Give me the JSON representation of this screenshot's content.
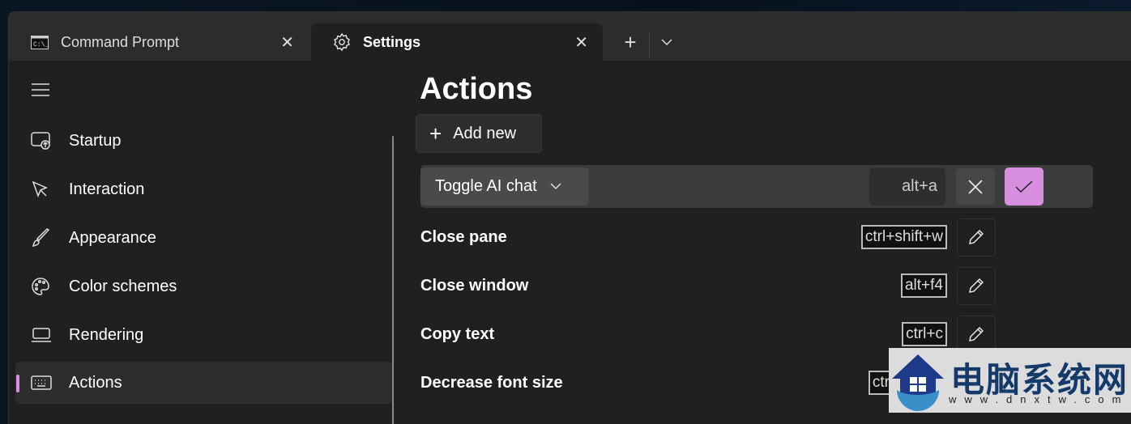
{
  "tabs": [
    {
      "label": "Command Prompt",
      "icon": "cmd-icon"
    },
    {
      "label": "Settings",
      "icon": "gear-icon",
      "active": true
    }
  ],
  "sidebar": {
    "items": [
      {
        "label": "Startup",
        "icon": "startup-icon"
      },
      {
        "label": "Interaction",
        "icon": "cursor-icon"
      },
      {
        "label": "Appearance",
        "icon": "brush-icon"
      },
      {
        "label": "Color schemes",
        "icon": "palette-icon"
      },
      {
        "label": "Rendering",
        "icon": "laptop-icon"
      },
      {
        "label": "Actions",
        "icon": "keyboard-icon",
        "selected": true
      }
    ]
  },
  "main": {
    "title": "Actions",
    "add_new": "Add new",
    "editing": {
      "action": "Toggle AI chat",
      "keys": "alt+a"
    },
    "actions": [
      {
        "name": "Close pane",
        "keys": "ctrl+shift+w"
      },
      {
        "name": "Close window",
        "keys": "alt+f4"
      },
      {
        "name": "Copy text",
        "keys": "ctrl+c"
      },
      {
        "name": "Decrease font size",
        "keys": "ctrl+minus"
      }
    ]
  },
  "colors": {
    "accent": "#d88fe0",
    "background": "#202020",
    "tabbar": "#2c2c2c"
  },
  "watermark": {
    "text": "电脑系统网",
    "url": "www.dnxtw.com"
  }
}
